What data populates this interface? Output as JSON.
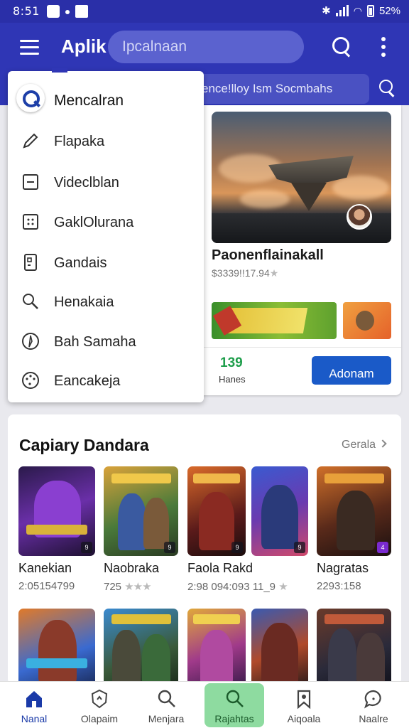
{
  "status_bar": {
    "time": "8:51",
    "battery": "52%"
  },
  "app_bar": {
    "title": "Aplik",
    "search_placeholder": "Ipcalnaan"
  },
  "sub_bar": {
    "text": "ence!lloy Ism  Socmbahs"
  },
  "drawer": {
    "header": "Mencalran",
    "items": [
      {
        "label": "Flapaka",
        "icon": "pencil-icon"
      },
      {
        "label": "Videclblan",
        "icon": "minus-box-icon"
      },
      {
        "label": "GaklOlurana",
        "icon": "grid-dots-icon"
      },
      {
        "label": "Gandais",
        "icon": "document-icon"
      },
      {
        "label": "Henakaia",
        "icon": "search-icon"
      },
      {
        "label": "Bah Samaha",
        "icon": "compass-icon"
      },
      {
        "label": "Eancakeja",
        "icon": "palette-icon"
      }
    ]
  },
  "featured": {
    "title": "Paonenflainakall",
    "meta": "$3339!!17.94",
    "stars": "★",
    "count": "139",
    "count_label": "Hanes",
    "button": "Adonam"
  },
  "section": {
    "title": "Capiary Dandara",
    "link": "Gerala",
    "games": [
      {
        "name": "Kanekian",
        "meta": "2:05154799",
        "stars": "",
        "badge": "9"
      },
      {
        "name": "Naobraka",
        "meta": "725",
        "stars": "★★★",
        "badge": "9"
      },
      {
        "name": "Faola Rakd",
        "meta": "2:98 094:093 11_9",
        "stars": "★",
        "badge": "9"
      },
      {
        "name": "",
        "meta": "",
        "stars": "",
        "badge": "9"
      },
      {
        "name": "Nagratas",
        "meta": "2293:158",
        "stars": "",
        "badge": "4"
      }
    ]
  },
  "bottom_nav": [
    {
      "label": "Nanal",
      "icon": "home-icon"
    },
    {
      "label": "Olapaim",
      "icon": "shield-icon"
    },
    {
      "label": "Menjara",
      "icon": "search-icon"
    },
    {
      "label": "Rajahtas",
      "icon": "search-icon"
    },
    {
      "label": "Aiqoala",
      "icon": "bookmark-icon"
    },
    {
      "label": "Naalre",
      "icon": "chat-icon"
    }
  ],
  "colors": {
    "primary": "#2f36b5",
    "accent_green": "#8edba0",
    "button_blue": "#1a5ac8",
    "count_green": "#1e9e4b"
  }
}
